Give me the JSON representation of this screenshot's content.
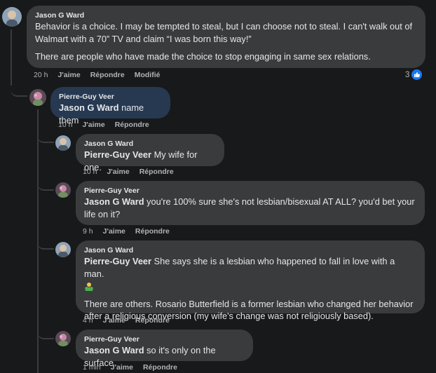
{
  "comments": [
    {
      "author": "Jason G Ward",
      "paragraphs": [
        "Behavior is a choice. I may be tempted to steal, but I can choose not to steal. I can't walk out of Walmart with a 70” TV and claim “I was born this way!”",
        "There are people who have made the choice to stop engaging in same sex relations."
      ],
      "time": "20 h",
      "like": "J'aime",
      "reply": "Répondre",
      "edited": "Modifié",
      "reaction_count": "3"
    },
    {
      "author": "Pierre-Guy Veer",
      "mention": "Jason G Ward",
      "text": " name them",
      "time": "10 h",
      "like": "J'aime",
      "reply": "Répondre"
    },
    {
      "author": "Jason G Ward",
      "mention": "Pierre-Guy Veer",
      "text": " My wife for one.",
      "time": "10 h",
      "like": "J'aime",
      "reply": "Répondre"
    },
    {
      "author": "Pierre-Guy Veer",
      "mention": "Jason G Ward",
      "text": " you're 100% sure she's not lesbian/bisexual AT ALL? you'd bet your life on it?",
      "time": "9 h",
      "like": "J'aime",
      "reply": "Répondre"
    },
    {
      "author": "Jason G Ward",
      "mention": "Pierre-Guy Veer",
      "text": " She says she is a lesbian who happened to fall in love with a man.",
      "emoji": "person-shrugging-emoji",
      "text2": "There are others. Rosario Butterfield is a former lesbian who changed her behavior after a religious conversion (my wife's change was not religiously based).",
      "time": "4 h",
      "like": "J'aime",
      "reply": "Répondre"
    },
    {
      "author": "Pierre-Guy Veer",
      "mention": "Jason G Ward",
      "text": " so it's only on the surface",
      "time": "1 min",
      "like": "J'aime",
      "reply": "Répondre"
    }
  ],
  "colors": {
    "background": "#18191a",
    "bubble": "#3a3b3c",
    "highlight_bubble": "#263951",
    "like_blue": "#1877f2"
  }
}
